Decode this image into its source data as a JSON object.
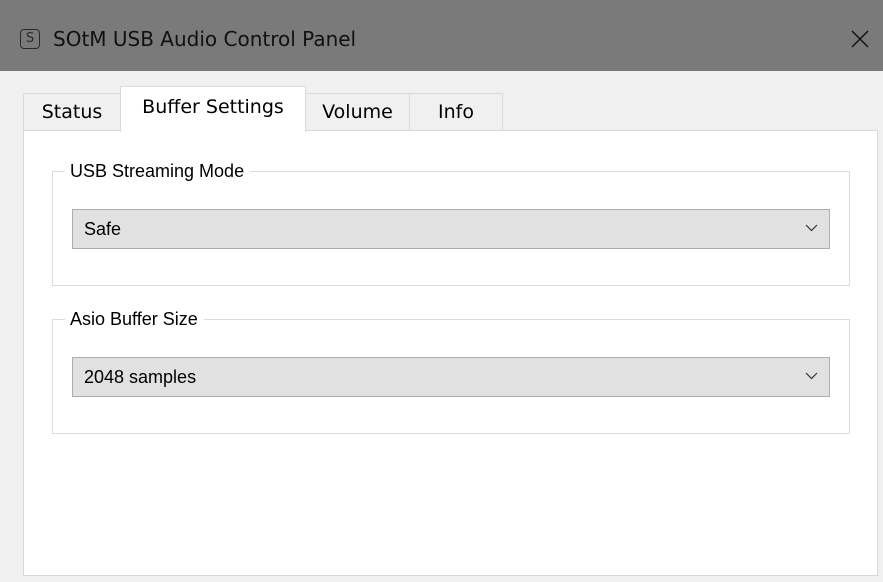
{
  "window": {
    "title": "SOtM USB Audio Control Panel",
    "app_icon_glyph": "S",
    "app_icon": "sotm-logo-icon",
    "close_icon": "close-icon",
    "titlebar_color": "#7a7a7a"
  },
  "tabs": [
    {
      "label": "Status",
      "active": false
    },
    {
      "label": "Buffer Settings",
      "active": true
    },
    {
      "label": "Volume",
      "active": false
    },
    {
      "label": "Info",
      "active": false
    }
  ],
  "streaming_mode": {
    "legend": "USB Streaming Mode",
    "selected": "Safe",
    "icon": "chevron-down-icon"
  },
  "asio_buffer": {
    "legend": "Asio Buffer Size",
    "selected": "2048 samples",
    "icon": "chevron-down-icon"
  }
}
